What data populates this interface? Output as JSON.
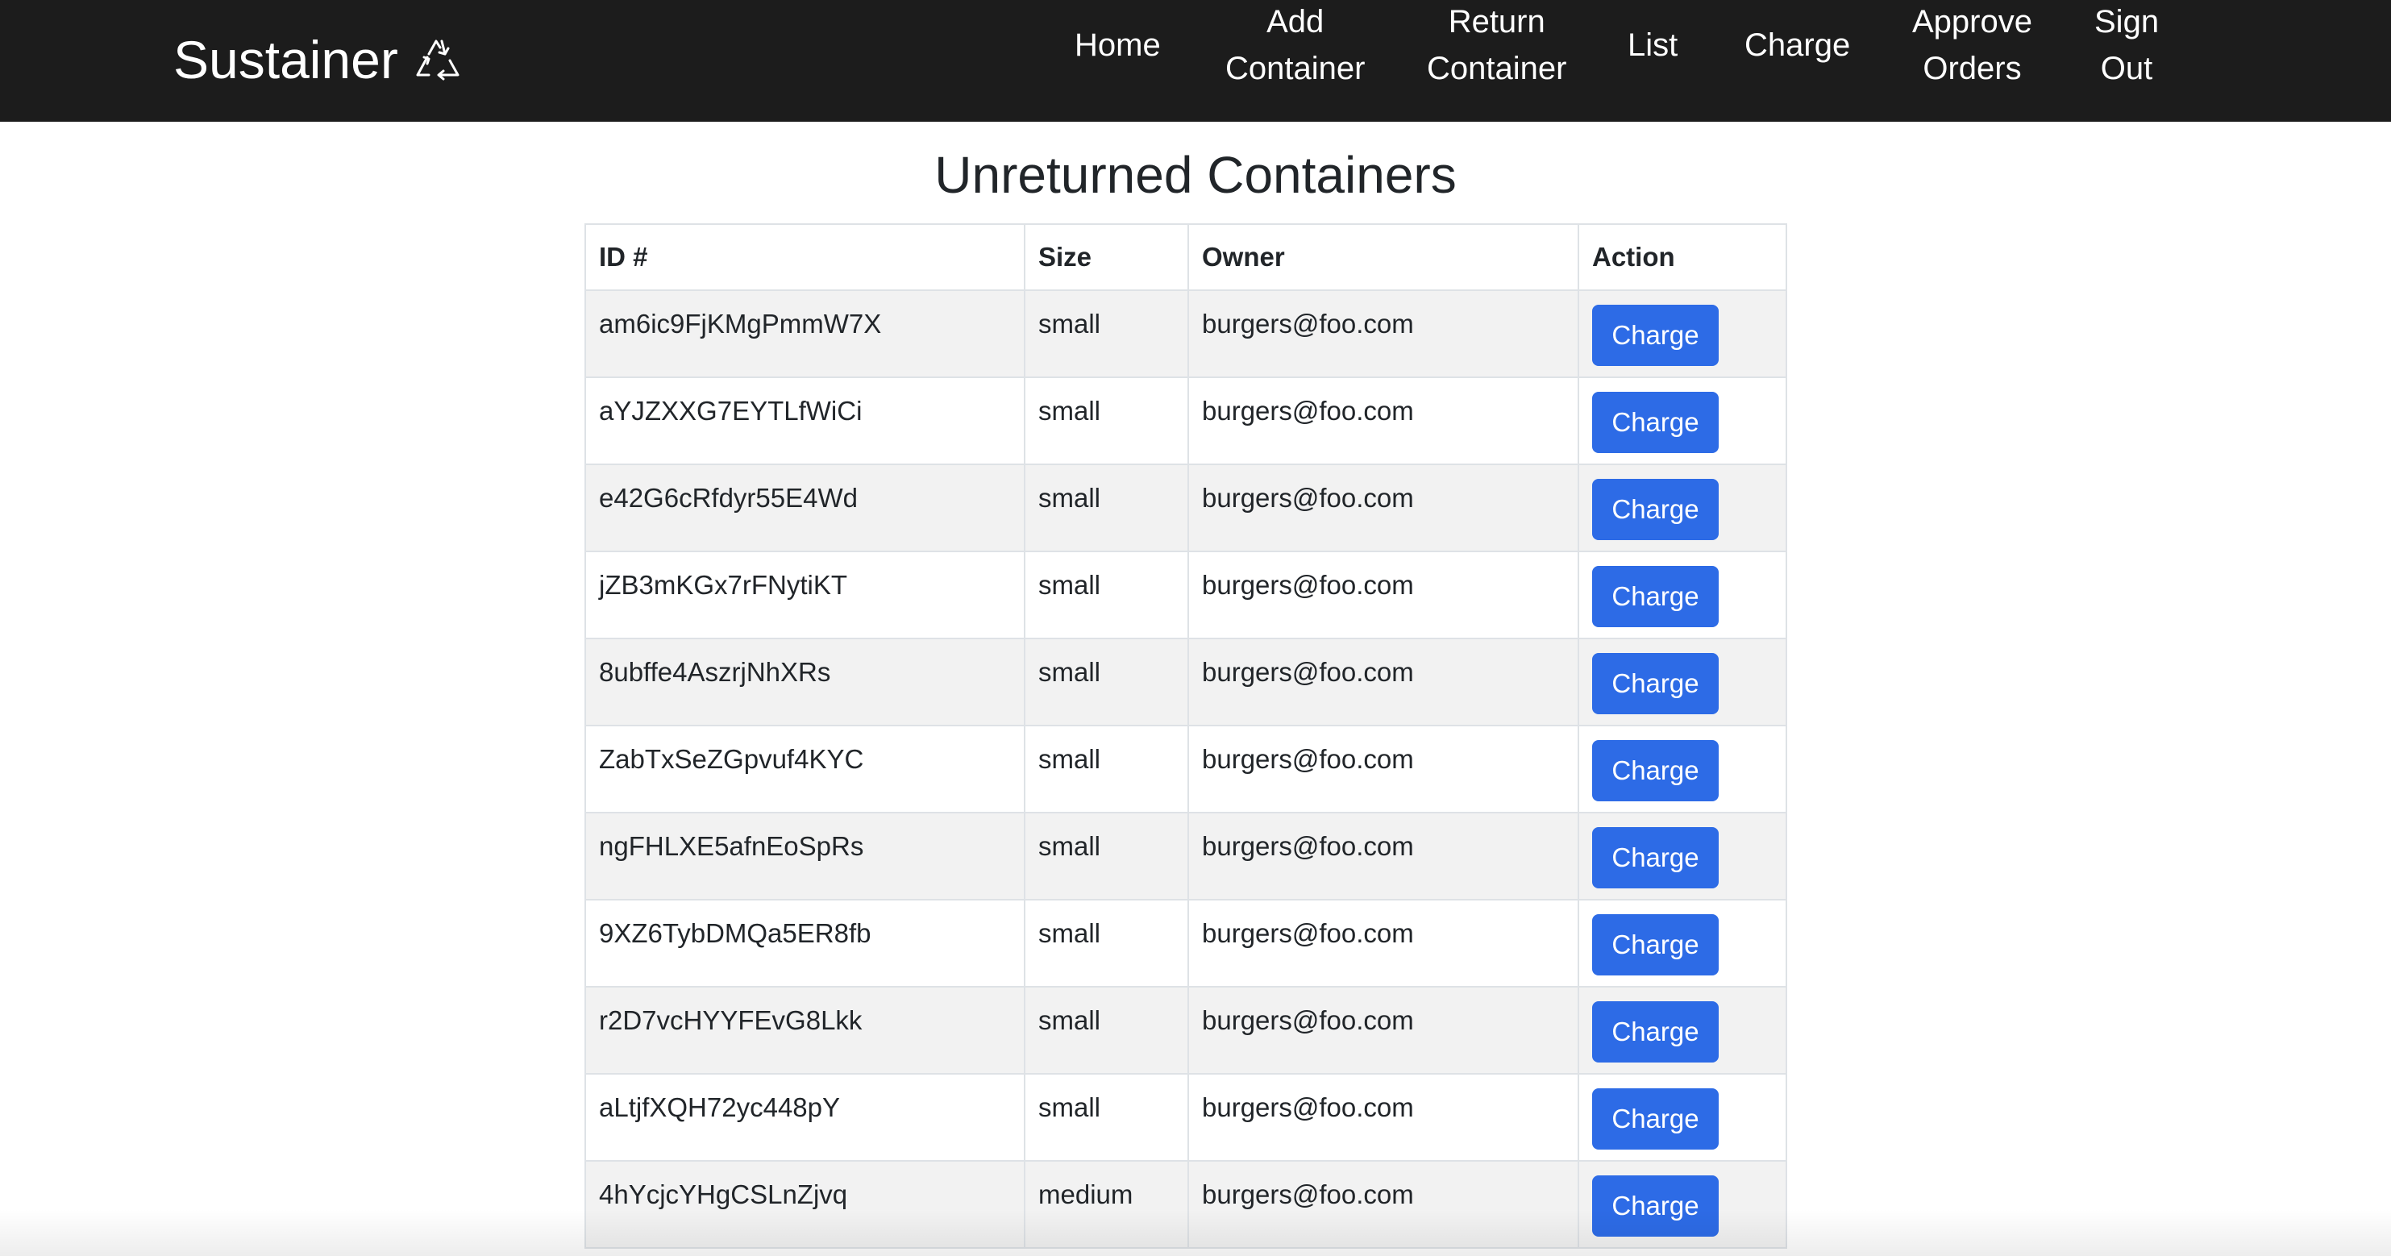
{
  "navbar": {
    "brand": "Sustainer",
    "brand_icon": "recycle-icon",
    "links": {
      "home": "Home",
      "add_container_1": "Add",
      "add_container_2": "Container",
      "return_container_1": "Return",
      "return_container_2": "Container",
      "list": "List",
      "charge": "Charge",
      "approve_orders_1": "Approve",
      "approve_orders_2": "Orders",
      "sign_out_1": "Sign",
      "sign_out_2": "Out"
    }
  },
  "main": {
    "title": "Unreturned Containers",
    "table": {
      "headers": {
        "id": "ID #",
        "size": "Size",
        "owner": "Owner",
        "action": "Action"
      },
      "rows": [
        {
          "id": "am6ic9FjKMgPmmW7X",
          "size": "small",
          "owner": "burgers@foo.com",
          "action": "Charge"
        },
        {
          "id": "aYJZXXG7EYTLfWiCi",
          "size": "small",
          "owner": "burgers@foo.com",
          "action": "Charge"
        },
        {
          "id": "e42G6cRfdyr55E4Wd",
          "size": "small",
          "owner": "burgers@foo.com",
          "action": "Charge"
        },
        {
          "id": "jZB3mKGx7rFNytiKT",
          "size": "small",
          "owner": "burgers@foo.com",
          "action": "Charge"
        },
        {
          "id": "8ubffe4AszrjNhXRs",
          "size": "small",
          "owner": "burgers@foo.com",
          "action": "Charge"
        },
        {
          "id": "ZabTxSeZGpvuf4KYC",
          "size": "small",
          "owner": "burgers@foo.com",
          "action": "Charge"
        },
        {
          "id": "ngFHLXE5afnEoSpRs",
          "size": "small",
          "owner": "burgers@foo.com",
          "action": "Charge"
        },
        {
          "id": "9XZ6TybDMQa5ER8fb",
          "size": "small",
          "owner": "burgers@foo.com",
          "action": "Charge"
        },
        {
          "id": "r2D7vcHYYFEvG8Lkk",
          "size": "small",
          "owner": "burgers@foo.com",
          "action": "Charge"
        },
        {
          "id": "aLtjfXQH72yc448pY",
          "size": "small",
          "owner": "burgers@foo.com",
          "action": "Charge"
        },
        {
          "id": "4hYcjcYHgCSLnZjvq",
          "size": "medium",
          "owner": "burgers@foo.com",
          "action": "Charge"
        }
      ]
    }
  },
  "colors": {
    "navbar_bg": "#1c1c1c",
    "button_bg": "#2d6be6",
    "stripe_bg": "#f2f2f2",
    "border": "#dee2e6"
  }
}
